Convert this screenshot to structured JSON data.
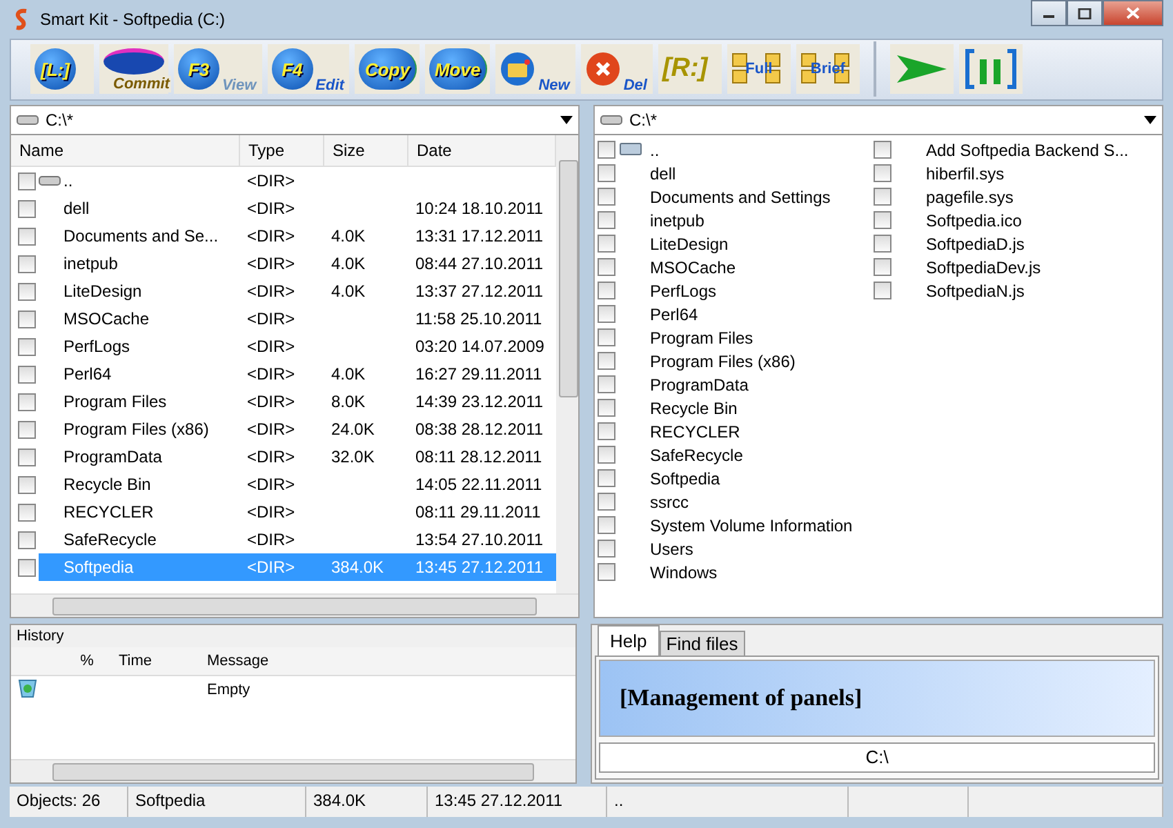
{
  "window": {
    "title": "Smart Kit - Softpedia (C:)"
  },
  "toolbar": [
    {
      "kind": "orb",
      "main": "[L:]"
    },
    {
      "kind": "ellipse",
      "sub": "Commit"
    },
    {
      "kind": "orb",
      "main": "F3",
      "sub": "View",
      "faded": true
    },
    {
      "kind": "orb",
      "main": "F4",
      "sub": "Edit",
      "faded": false
    },
    {
      "kind": "double",
      "main": "Copy"
    },
    {
      "kind": "double",
      "main": "Move"
    },
    {
      "kind": "folder",
      "sub": "New"
    },
    {
      "kind": "del",
      "sub": "Del"
    },
    {
      "kind": "bracket",
      "main": "[R:]"
    },
    {
      "kind": "folders",
      "main": "Full"
    },
    {
      "kind": "folders",
      "main": "Brief"
    },
    {
      "kind": "arrow"
    },
    {
      "kind": "pause"
    }
  ],
  "left_panel": {
    "path": "C:\\*",
    "columns": [
      "Name",
      "Type",
      "Size",
      "Date"
    ],
    "rows": [
      {
        "name": "..",
        "type": "<DIR>",
        "size": "",
        "date": "",
        "checked": false,
        "selected": false,
        "kind": "up"
      },
      {
        "name": "dell",
        "type": "<DIR>",
        "size": "",
        "date": "10:24 18.10.2011",
        "checked": false,
        "selected": false
      },
      {
        "name": "Documents and Se...",
        "type": "<DIR>",
        "size": "4.0K",
        "date": "13:31 17.12.2011",
        "checked": false,
        "selected": false
      },
      {
        "name": "inetpub",
        "type": "<DIR>",
        "size": "4.0K",
        "date": "08:44 27.10.2011",
        "checked": false,
        "selected": false
      },
      {
        "name": "LiteDesign",
        "type": "<DIR>",
        "size": "4.0K",
        "date": "13:37 27.12.2011",
        "checked": false,
        "selected": false
      },
      {
        "name": "MSOCache",
        "type": "<DIR>",
        "size": "",
        "date": "11:58 25.10.2011",
        "checked": false,
        "selected": false
      },
      {
        "name": "PerfLogs",
        "type": "<DIR>",
        "size": "",
        "date": "03:20 14.07.2009",
        "checked": false,
        "selected": false
      },
      {
        "name": "Perl64",
        "type": "<DIR>",
        "size": "4.0K",
        "date": "16:27 29.11.2011",
        "checked": false,
        "selected": false
      },
      {
        "name": "Program Files",
        "type": "<DIR>",
        "size": "8.0K",
        "date": "14:39 23.12.2011",
        "checked": false,
        "selected": false
      },
      {
        "name": "Program Files (x86)",
        "type": "<DIR>",
        "size": "24.0K",
        "date": "08:38 28.12.2011",
        "checked": false,
        "selected": false
      },
      {
        "name": "ProgramData",
        "type": "<DIR>",
        "size": "32.0K",
        "date": "08:11 28.12.2011",
        "checked": false,
        "selected": false
      },
      {
        "name": "Recycle Bin",
        "type": "<DIR>",
        "size": "",
        "date": "14:05 22.11.2011",
        "checked": false,
        "selected": false
      },
      {
        "name": "RECYCLER",
        "type": "<DIR>",
        "size": "",
        "date": "08:11 29.11.2011",
        "checked": false,
        "selected": false
      },
      {
        "name": "SafeRecycle",
        "type": "<DIR>",
        "size": "",
        "date": "13:54 27.10.2011",
        "checked": false,
        "selected": false
      },
      {
        "name": "Softpedia",
        "type": "<DIR>",
        "size": "384.0K",
        "date": "13:45 27.12.2011",
        "checked": false,
        "selected": true
      }
    ]
  },
  "right_panel": {
    "path": "C:\\*",
    "columns_of_items": [
      [
        {
          "name": "..",
          "checked": false,
          "kind": "up"
        },
        {
          "name": "dell",
          "checked": false
        },
        {
          "name": "Documents and Settings",
          "checked": false
        },
        {
          "name": "inetpub",
          "checked": false
        },
        {
          "name": "LiteDesign",
          "checked": false
        },
        {
          "name": "MSOCache",
          "checked": false
        },
        {
          "name": "PerfLogs",
          "checked": false
        },
        {
          "name": "Perl64",
          "checked": false
        },
        {
          "name": "Program Files",
          "checked": false
        },
        {
          "name": "Program Files (x86)",
          "checked": false
        },
        {
          "name": "ProgramData",
          "checked": false
        },
        {
          "name": "Recycle Bin",
          "checked": false
        },
        {
          "name": "RECYCLER",
          "checked": false
        },
        {
          "name": "SafeRecycle",
          "checked": false
        },
        {
          "name": "Softpedia",
          "checked": false
        },
        {
          "name": "ssrcc",
          "checked": false
        },
        {
          "name": "System Volume Information",
          "checked": false
        },
        {
          "name": "Users",
          "checked": false
        },
        {
          "name": "Windows",
          "checked": false
        }
      ],
      [
        {
          "name": "Add Softpedia Backend S...",
          "checked": false
        },
        {
          "name": "hiberfil.sys",
          "checked": false
        },
        {
          "name": "pagefile.sys",
          "checked": false
        },
        {
          "name": "Softpedia.ico",
          "checked": false
        },
        {
          "name": "SoftpediaD.js",
          "checked": false
        },
        {
          "name": "SoftpediaDev.js",
          "checked": false
        },
        {
          "name": "SoftpediaN.js",
          "checked": false
        }
      ]
    ]
  },
  "history": {
    "title": "History",
    "columns": [
      "%",
      "Time",
      "Message"
    ],
    "rows": [
      {
        "percent": "",
        "time": "",
        "message": "Empty"
      }
    ]
  },
  "help": {
    "tabs": [
      {
        "label": "Help",
        "selected": true
      },
      {
        "label": "Find files",
        "selected": false
      }
    ],
    "heading": "[Management of panels]",
    "path": "C:\\"
  },
  "status_bar": [
    "Objects: 26",
    "Softpedia",
    "384.0K",
    "13:45 27.12.2011",
    ".."
  ]
}
